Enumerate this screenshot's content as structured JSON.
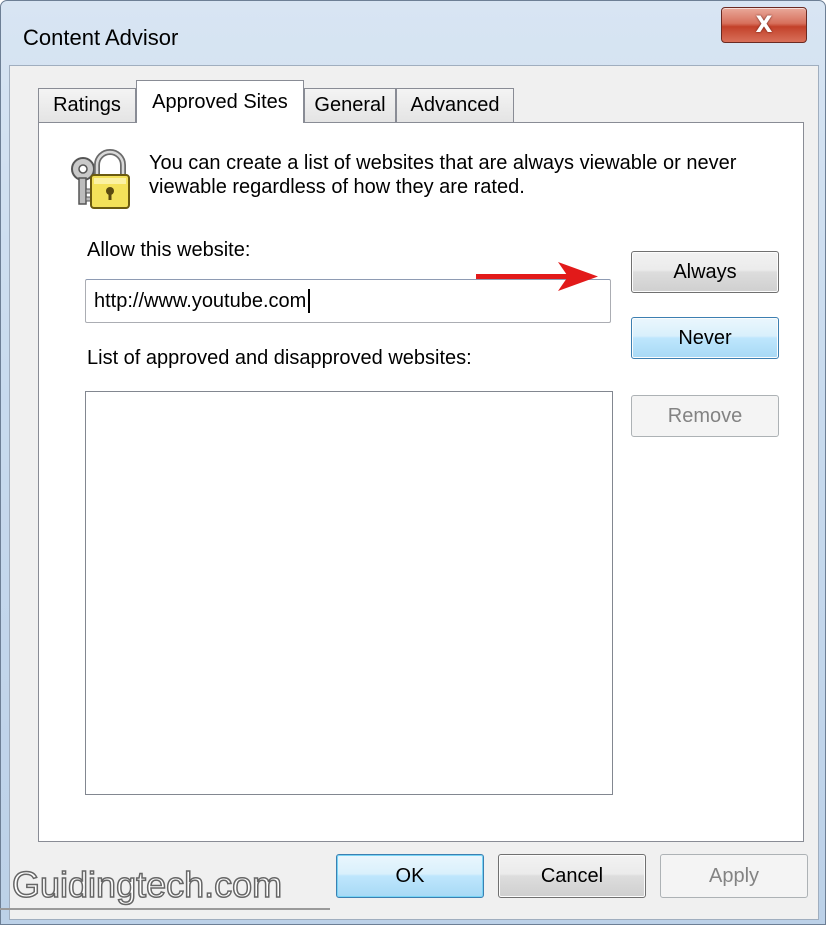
{
  "window": {
    "title": "Content Advisor",
    "close_label": "X"
  },
  "tabs": [
    {
      "label": "Ratings",
      "active": false
    },
    {
      "label": "Approved Sites",
      "active": true
    },
    {
      "label": "General",
      "active": false
    },
    {
      "label": "Advanced",
      "active": false
    }
  ],
  "approved_sites": {
    "info_text": "You can create a list of websites that are always viewable or never viewable regardless of how they are rated.",
    "allow_label": "Allow this website:",
    "url_value": "http://www.youtube.com",
    "list_label": "List of approved and disapproved websites:",
    "sites": [],
    "always_label": "Always",
    "never_label": "Never",
    "remove_label": "Remove"
  },
  "footer": {
    "ok_label": "OK",
    "cancel_label": "Cancel",
    "apply_label": "Apply"
  },
  "watermark": "Guidingtech.com",
  "colors": {
    "arrow": "#e21a1a",
    "hot_button": "#bee6fd",
    "close_button": "#c3412a"
  },
  "icons": {
    "lock": "lock-keys-icon",
    "arrow": "red-arrow-annotation"
  }
}
